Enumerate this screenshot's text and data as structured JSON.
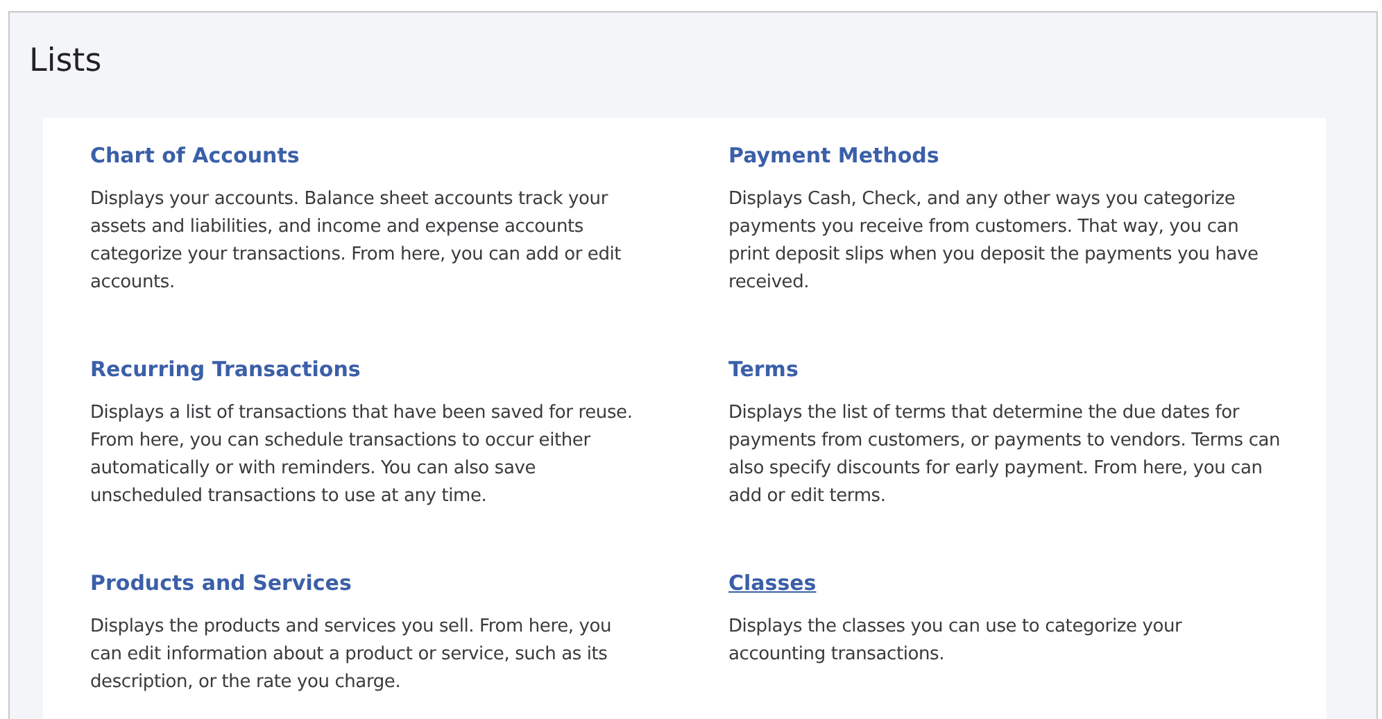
{
  "page": {
    "title": "Lists"
  },
  "lists": [
    {
      "title": "Chart of Accounts",
      "hovered": false,
      "description": "Displays your accounts. Balance sheet accounts track your assets and liabilities, and income and expense accounts categorize your transactions. From here, you can add or edit accounts."
    },
    {
      "title": "Payment Methods",
      "hovered": false,
      "description": "Displays Cash, Check, and any other ways you categorize payments you receive from customers. That way, you can print deposit slips when you deposit the payments you have received."
    },
    {
      "title": "Recurring Transactions",
      "hovered": false,
      "description": "Displays a list of transactions that have been saved for reuse. From here, you can schedule transactions to occur either automatically or with reminders. You can also save unscheduled transactions to use at any time."
    },
    {
      "title": "Terms",
      "hovered": false,
      "description": "Displays the list of terms that determine the due dates for payments from customers, or payments to vendors. Terms can also specify discounts for early payment. From here, you can add or edit terms."
    },
    {
      "title": "Products and Services",
      "hovered": false,
      "description": "Displays the products and services you sell. From here, you can edit information about a product or service, such as its description, or the rate you charge."
    },
    {
      "title": "Classes",
      "hovered": true,
      "description": "Displays the classes you can use to categorize your accounting transactions."
    }
  ]
}
